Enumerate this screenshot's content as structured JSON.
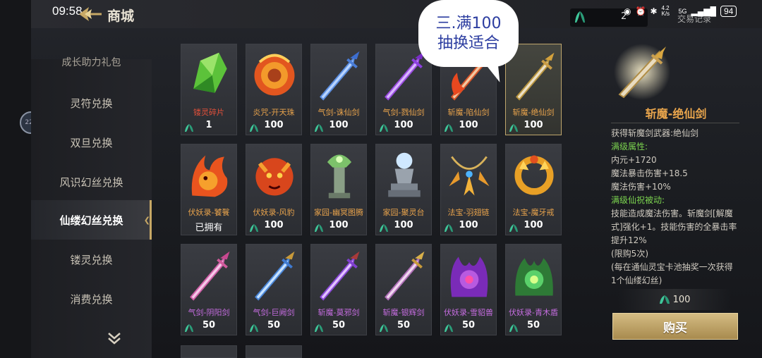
{
  "status_bar": {
    "time": "09:58",
    "net_speed": "4.2 K/s",
    "signal": "5G",
    "battery": "94"
  },
  "header": {
    "title": "商城",
    "currency_value": "2",
    "records_label": "交易记录"
  },
  "avatar_label": "222",
  "sidebar": {
    "items": [
      {
        "label": "成长助力礼包",
        "active": false
      },
      {
        "label": "灵符兑换",
        "active": false
      },
      {
        "label": "双旦兑换",
        "active": false
      },
      {
        "label": "风识幻丝兑换",
        "active": false
      },
      {
        "label": "仙缕幻丝兑换",
        "active": true
      },
      {
        "label": "镂灵兑换",
        "active": false
      },
      {
        "label": "消费兑换",
        "active": false
      }
    ]
  },
  "bubble": {
    "line1": "三.满100",
    "line2": "抽换适合"
  },
  "items": [
    {
      "name": "镂灵碎片",
      "price": "1",
      "color": "red",
      "icon": "green-crystal-icon"
    },
    {
      "name": "炎咒-开天珠",
      "price": "100",
      "color": "orange",
      "icon": "fire-orb-icon"
    },
    {
      "name": "气剑-诛仙剑",
      "price": "100",
      "color": "orange",
      "icon": "blue-sword-icon"
    },
    {
      "name": "气剑-戮仙剑",
      "price": "100",
      "color": "orange",
      "icon": "purple-sword-icon"
    },
    {
      "name": "斩魔-陷仙剑",
      "price": "100",
      "color": "orange",
      "icon": "flame-sword-icon"
    },
    {
      "name": "斩魔-绝仙剑",
      "price": "100",
      "color": "orange",
      "icon": "gold-sword-icon",
      "selected": true
    },
    {
      "name": "伏妖录-饕餮",
      "price": "已拥有",
      "color": "orange",
      "icon": "fire-beast-icon",
      "owned": true
    },
    {
      "name": "伏妖录-风豹",
      "price": "100",
      "color": "orange",
      "icon": "fire-leopard-icon"
    },
    {
      "name": "家园-幽冥图腾",
      "price": "100",
      "color": "orange",
      "icon": "totem-icon"
    },
    {
      "name": "家园-聚灵台",
      "price": "100",
      "color": "orange",
      "icon": "altar-icon"
    },
    {
      "name": "法宝-羽翅链",
      "price": "100",
      "color": "orange",
      "icon": "feather-necklace-icon"
    },
    {
      "name": "法宝-魔牙戒",
      "price": "100",
      "color": "orange",
      "icon": "fang-ring-icon"
    },
    {
      "name": "气剑-阴阳剑",
      "price": "50",
      "color": "purple",
      "icon": "pink-sword-icon"
    },
    {
      "name": "气剑-巨阙剑",
      "price": "50",
      "color": "purple",
      "icon": "ice-sword-icon"
    },
    {
      "name": "斩魔-莫邪剑",
      "price": "50",
      "color": "purple",
      "icon": "violet-sword-icon"
    },
    {
      "name": "斩魔-银辉剑",
      "price": "50",
      "color": "purple",
      "icon": "silver-sword-icon"
    },
    {
      "name": "伏妖录-雪貂兽",
      "price": "50",
      "color": "purple",
      "icon": "purple-beast-icon"
    },
    {
      "name": "伏妖录-青木盾",
      "price": "50",
      "color": "purple",
      "icon": "green-beast-icon"
    }
  ],
  "detail": {
    "title": "斩魔-绝仙剑",
    "desc": "获得斩魔剑武器:绝仙剑",
    "attr_title": "满级属性:",
    "attrs": [
      "内元+1720",
      "魔法暴击伤害+18.5",
      "魔法伤害+10%"
    ],
    "passive_title": "满级仙祝被动:",
    "passive_lines": [
      "技能造成魔法伤害。斩魔剑[解魔",
      "式]强化+1。技能伤害的全暴击率",
      "提升12%"
    ],
    "limit": "(限购5次)",
    "note_lines": [
      "(每在通仙灵宝卡池抽奖一次获得",
      "1个仙缕幻丝)"
    ],
    "price": "100",
    "buy_label": "购买"
  }
}
